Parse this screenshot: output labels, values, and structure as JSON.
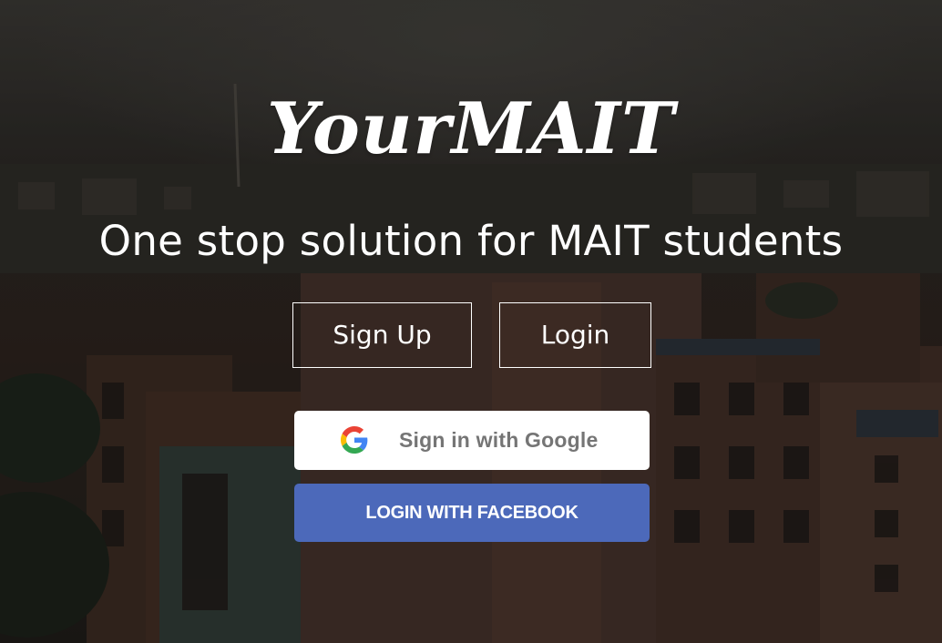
{
  "brand": {
    "logo_text": "YourMAIT",
    "tagline": "One stop solution for MAIT students"
  },
  "auth": {
    "signup_label": "Sign Up",
    "login_label": "Login",
    "google_label": "Sign in with Google",
    "facebook_label": "LOGIN WITH FACEBOOK"
  },
  "icons": {
    "google": "google-g-icon"
  },
  "colors": {
    "facebook_blue": "#4c69ba",
    "google_text": "#757575",
    "google_bg": "#ffffff",
    "text_primary": "#ffffff",
    "outline": "#ffffff"
  }
}
